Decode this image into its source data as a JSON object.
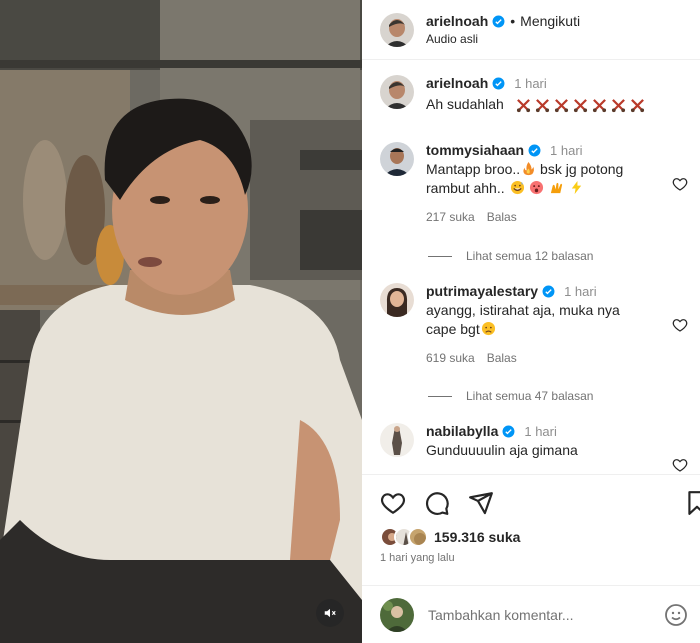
{
  "post": {
    "author": "arielnoah",
    "follow_status": "Mengikuti",
    "audio": "Audio asli",
    "caption": {
      "username": "arielnoah",
      "time": "1 hari",
      "text": "Ah sudahlah"
    }
  },
  "comments": [
    {
      "username": "tommysiahaan",
      "time": "1 hari",
      "text_line1": "Mantapp broo..",
      "text_line1b": " bsk jg potong",
      "text_line2": "rambut ahh..",
      "likes": "217 suka",
      "reply_label": "Balas",
      "view_replies": "Lihat semua 12 balasan"
    },
    {
      "username": "putrimayalestary",
      "time": "1 hari",
      "text_line1": "ayangg, istirahat aja, muka nya",
      "text_line2": "cape bgt",
      "likes": "619 suka",
      "reply_label": "Balas",
      "view_replies": "Lihat semua 47 balasan"
    },
    {
      "username": "nabilabylla",
      "time": "1 hari",
      "text_line1": "Gunduuuulin aja gimana"
    }
  ],
  "actions": {
    "likes_count": "159.316 suka",
    "date": "1 hari yang lalu",
    "comment_placeholder": "Tambahkan komentar..."
  },
  "icons": {
    "verified": "verified-badge-icon",
    "like": "heart-icon",
    "comment": "comment-icon",
    "share": "share-icon",
    "save": "bookmark-icon",
    "mute": "speaker-muted-icon",
    "emoji": "smiley-icon"
  },
  "colors": {
    "verified_blue": "#0095f6",
    "muted_text": "#737373",
    "primary_text": "#262626"
  }
}
